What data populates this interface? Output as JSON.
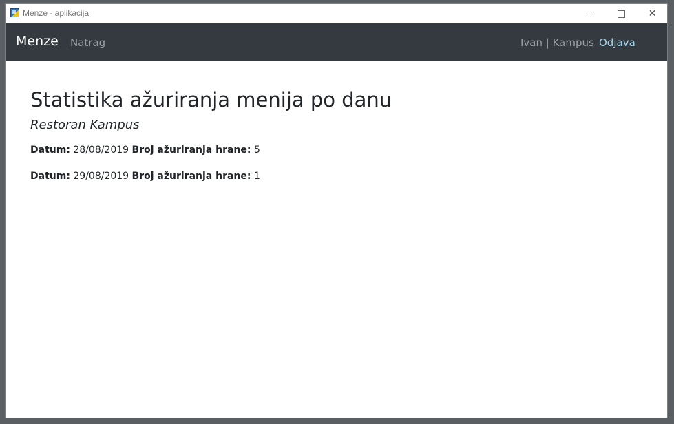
{
  "window": {
    "title": "Menze - aplikacija"
  },
  "navbar": {
    "brand": "Menze",
    "back_label": "Natrag",
    "user_label": "Ivan | Kampus",
    "logout_label": "Odjava"
  },
  "main": {
    "heading": "Statistika ažuriranja menija po danu",
    "restaurant": "Restoran Kampus",
    "date_label": "Datum:",
    "count_label": "Broj ažuriranja hrane:",
    "rows": [
      {
        "date": "28/08/2019",
        "count": "5"
      },
      {
        "date": "29/08/2019",
        "count": "1"
      }
    ]
  },
  "colors": {
    "navbar_bg": "#343a40",
    "logout_link": "#9fd4ea"
  }
}
